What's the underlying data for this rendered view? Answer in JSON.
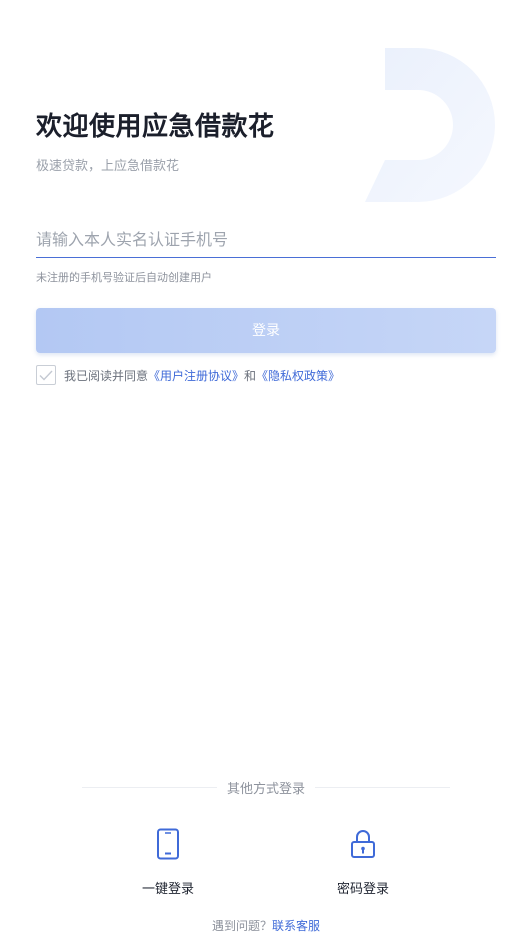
{
  "header": {
    "title": "欢迎使用应急借款花",
    "subtitle": "极速贷款，上应急借款花"
  },
  "form": {
    "phone_placeholder": "请输入本人实名认证手机号",
    "phone_value": "",
    "hint": "未注册的手机号验证后自动创建用户",
    "login_label": "登录"
  },
  "agreement": {
    "checked": true,
    "prefix": "我已阅读并同意",
    "user_agreement": "《用户注册协议》",
    "joiner": "和",
    "privacy_policy": "《隐私权政策》"
  },
  "other_login": {
    "divider_label": "其他方式登录",
    "methods": [
      {
        "label": "一键登录",
        "icon": "phone-icon"
      },
      {
        "label": "密码登录",
        "icon": "lock-icon"
      }
    ]
  },
  "help": {
    "question": "遇到问题？",
    "contact": "联系客服"
  },
  "colors": {
    "accent": "#3f6ad8",
    "button_bg": "#b9cdf5",
    "title": "#1b1f2b",
    "muted": "#9aa0aa"
  }
}
